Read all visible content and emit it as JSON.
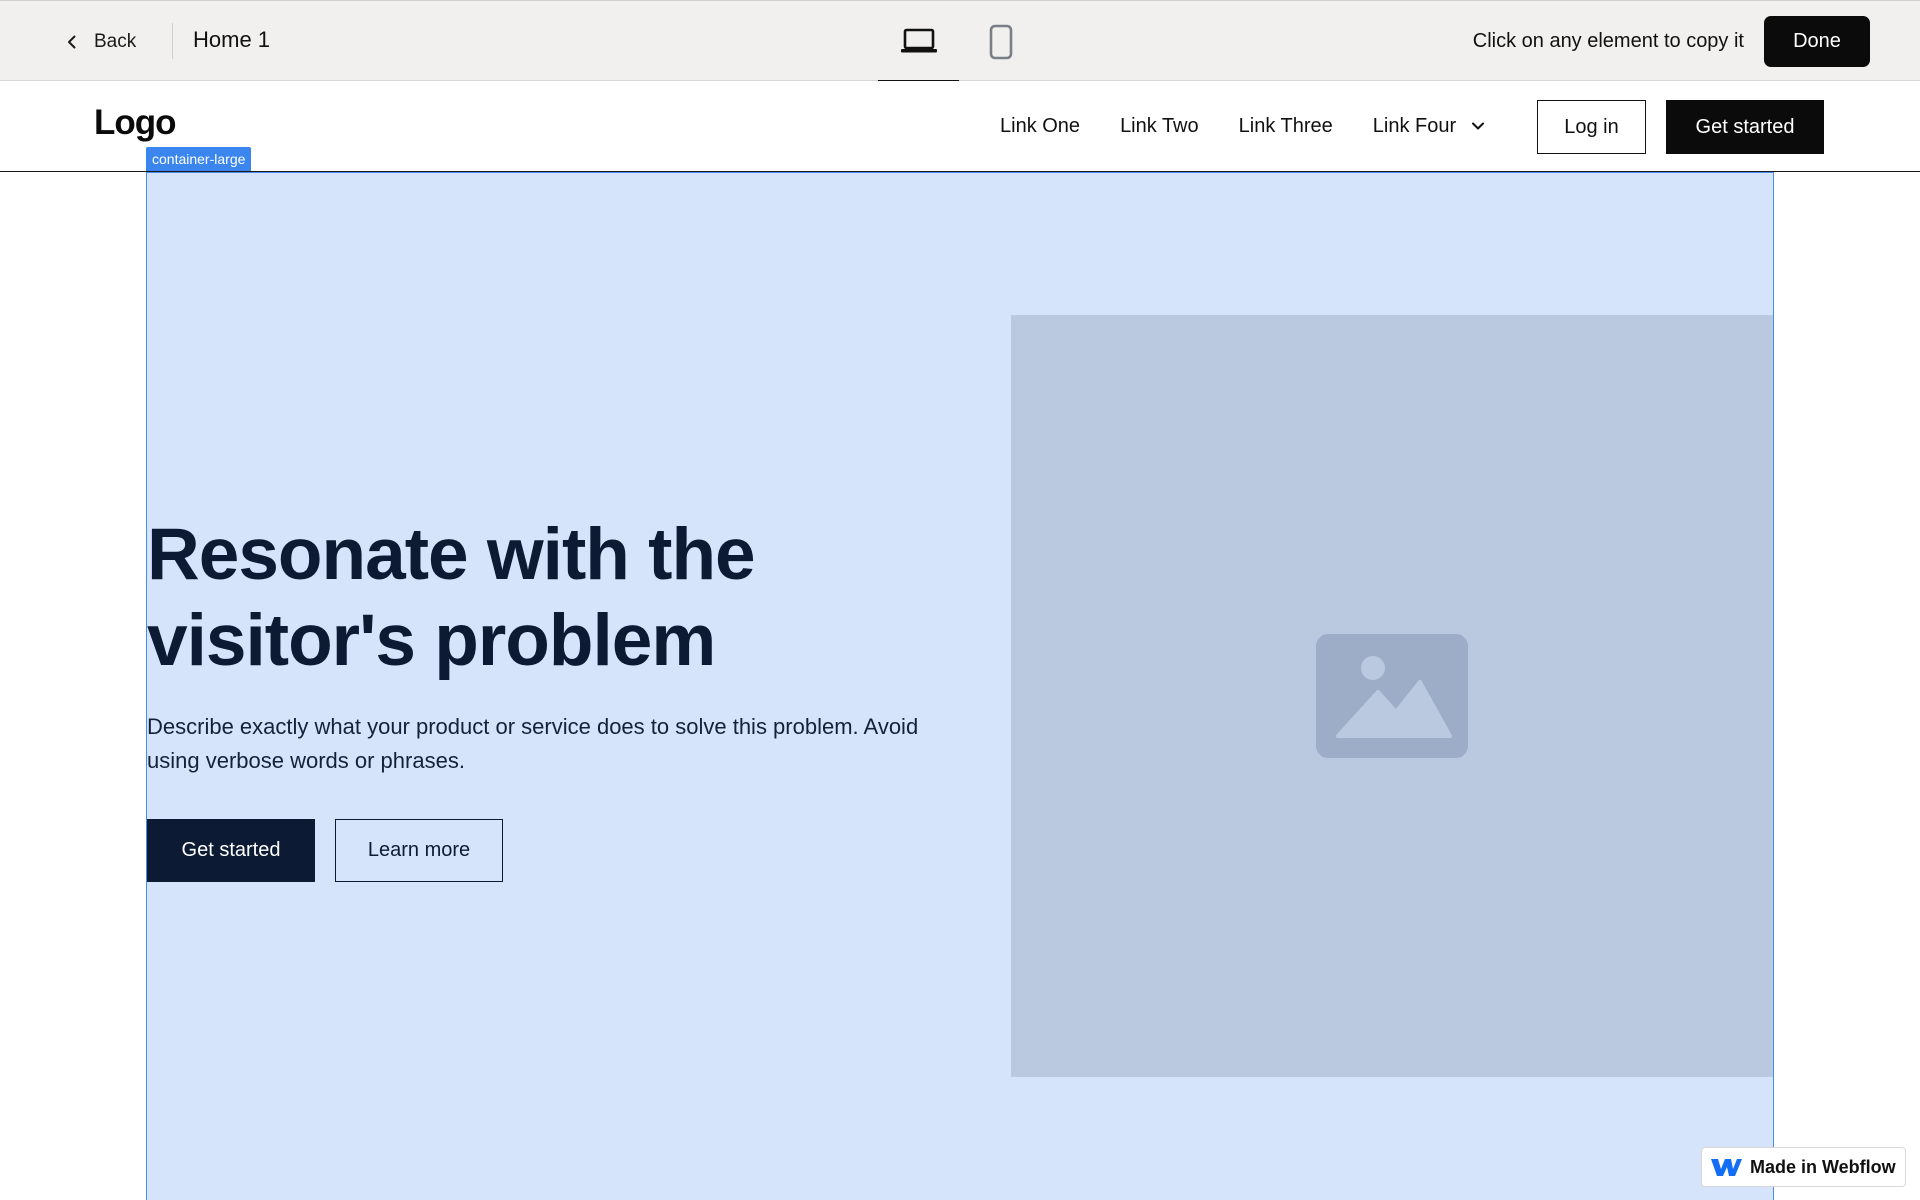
{
  "toolbar": {
    "back_label": "Back",
    "page_name": "Home 1",
    "hint": "Click on any element to copy it",
    "done_label": "Done",
    "devices": [
      {
        "icon": "laptop-icon",
        "active": true
      },
      {
        "icon": "mobile-icon",
        "active": false
      }
    ]
  },
  "navbar": {
    "logo": "Logo",
    "links": [
      "Link One",
      "Link Two",
      "Link Three"
    ],
    "dropdown_label": "Link Four",
    "login_label": "Log in",
    "cta_label": "Get started"
  },
  "selection": {
    "tag": "container-large",
    "color": "#3a86ee"
  },
  "hero": {
    "title": "Resonate with the visitor's problem",
    "description": "Describe exactly what your product or service does to solve this problem. Avoid using verbose words or phrases.",
    "primary_label": "Get started",
    "secondary_label": "Learn more",
    "image_icon": "image-placeholder-icon"
  },
  "badge": {
    "label": "Made in Webflow",
    "icon": "webflow-logo-icon"
  },
  "colors": {
    "toolbar_bg": "#f1f0ee",
    "selection_fill": "#d6e4fb",
    "image_placeholder": "#bac8e0",
    "dark_navy": "#0c1a33"
  }
}
